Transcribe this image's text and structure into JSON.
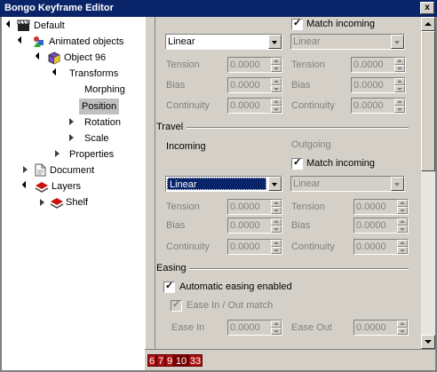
{
  "window": {
    "title": "Bongo Keyframe Editor",
    "close_glyph": "x"
  },
  "tree": {
    "items": [
      {
        "label": "Default",
        "icon": "clapperboard-icon"
      },
      {
        "label": "Animated objects",
        "icon": "animated-objects-icon"
      },
      {
        "label": "Object 96",
        "icon": "object-cube-icon"
      },
      {
        "label": "Transforms"
      },
      {
        "label": "Morphing"
      },
      {
        "label": "Position"
      },
      {
        "label": "Rotation"
      },
      {
        "label": "Scale"
      },
      {
        "label": "Properties"
      },
      {
        "label": "Document",
        "icon": "document-icon"
      },
      {
        "label": "Layers",
        "icon": "layers-icon"
      },
      {
        "label": "Shelf",
        "icon": "shelf-icon"
      }
    ],
    "selected": "Position"
  },
  "top_block": {
    "match_incoming_label": "Match incoming",
    "match_incoming_checked": true,
    "incoming_interp": "Linear",
    "outgoing_interp": "Linear",
    "rows": [
      {
        "label": "Tension",
        "in_value": "0.0000",
        "out_value": "0.0000"
      },
      {
        "label": "Bias",
        "in_value": "0.0000",
        "out_value": "0.0000"
      },
      {
        "label": "Continuity",
        "in_value": "0.0000",
        "out_value": "0.0000"
      }
    ]
  },
  "travel": {
    "section_label": "Travel",
    "incoming_label": "Incoming",
    "outgoing_label": "Outgoing",
    "match_incoming_label": "Match incoming",
    "match_incoming_checked": true,
    "incoming_interp": "Linear",
    "outgoing_interp": "Linear",
    "rows": [
      {
        "label": "Tension",
        "in_value": "0.0000",
        "out_value": "0.0000"
      },
      {
        "label": "Bias",
        "in_value": "0.0000",
        "out_value": "0.0000"
      },
      {
        "label": "Continuity",
        "in_value": "0.0000",
        "out_value": "0.0000"
      }
    ]
  },
  "easing": {
    "section_label": "Easing",
    "auto_label": "Automatic easing enabled",
    "auto_checked": true,
    "match_label": "Ease In / Out match",
    "match_checked": true,
    "ease_in_label": "Ease In",
    "ease_in_value": "0.0000",
    "ease_out_label": "Ease Out",
    "ease_out_value": "0.0000"
  },
  "status": {
    "badges": [
      "6",
      "7",
      "9",
      "10",
      "33"
    ]
  },
  "colors": {
    "title_bar": "#0a246a",
    "panel": "#d4d0c8",
    "selection": "#0a246a",
    "badge": "#aa1111"
  }
}
